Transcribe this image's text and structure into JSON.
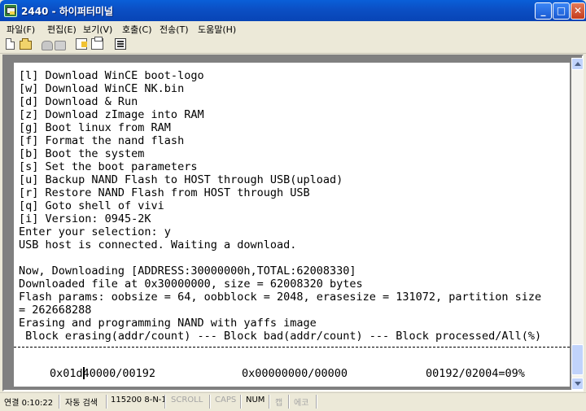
{
  "window": {
    "title": "2440 - 하이퍼터미널"
  },
  "menubar": {
    "items": [
      "파일(F)",
      "편집(E)",
      "보기(V)",
      "호출(C)",
      "전송(T)",
      "도움말(H)"
    ]
  },
  "toolbar": {
    "icons": [
      "new-icon",
      "open-icon",
      "call-icon",
      "disconnect-icon",
      "send-icon",
      "receive-icon",
      "properties-icon"
    ]
  },
  "terminal": {
    "lines": [
      "[l] Download WinCE boot-logo",
      "[w] Download WinCE NK.bin",
      "[d] Download & Run",
      "[z] Download zImage into RAM",
      "[g] Boot linux from RAM",
      "[f] Format the nand flash",
      "[b] Boot the system",
      "[s] Set the boot parameters",
      "[u] Backup NAND Flash to HOST through USB(upload)",
      "[r] Restore NAND Flash from HOST through USB",
      "[q] Goto shell of vivi",
      "[i] Version: 0945-2K",
      "Enter your selection: y",
      "USB host is connected. Waiting a download.",
      "",
      "Now, Downloading [ADDRESS:30000000h,TOTAL:62008330]",
      "Downloaded file at 0x30000000, size = 62008320 bytes",
      "Flash params: oobsize = 64, oobblock = 2048, erasesize = 131072, partition size",
      "= 262668288",
      "Erasing and programming NAND with yaffs image",
      " Block erasing(addr/count) --- Block bad(addr/count) --- Block processed/All(%)"
    ],
    "progress": {
      "erasing": "0x01d40000/00192",
      "bad": "0x00000000/00000",
      "processed": "00192/02004=09%"
    }
  },
  "statusbar": {
    "connected": "연결 0:10:22",
    "detect": "자동 검색",
    "port": "115200 8-N-1",
    "scroll": "SCROLL",
    "caps": "CAPS",
    "num": "NUM",
    "capture": "캡",
    "echo": "에코"
  }
}
